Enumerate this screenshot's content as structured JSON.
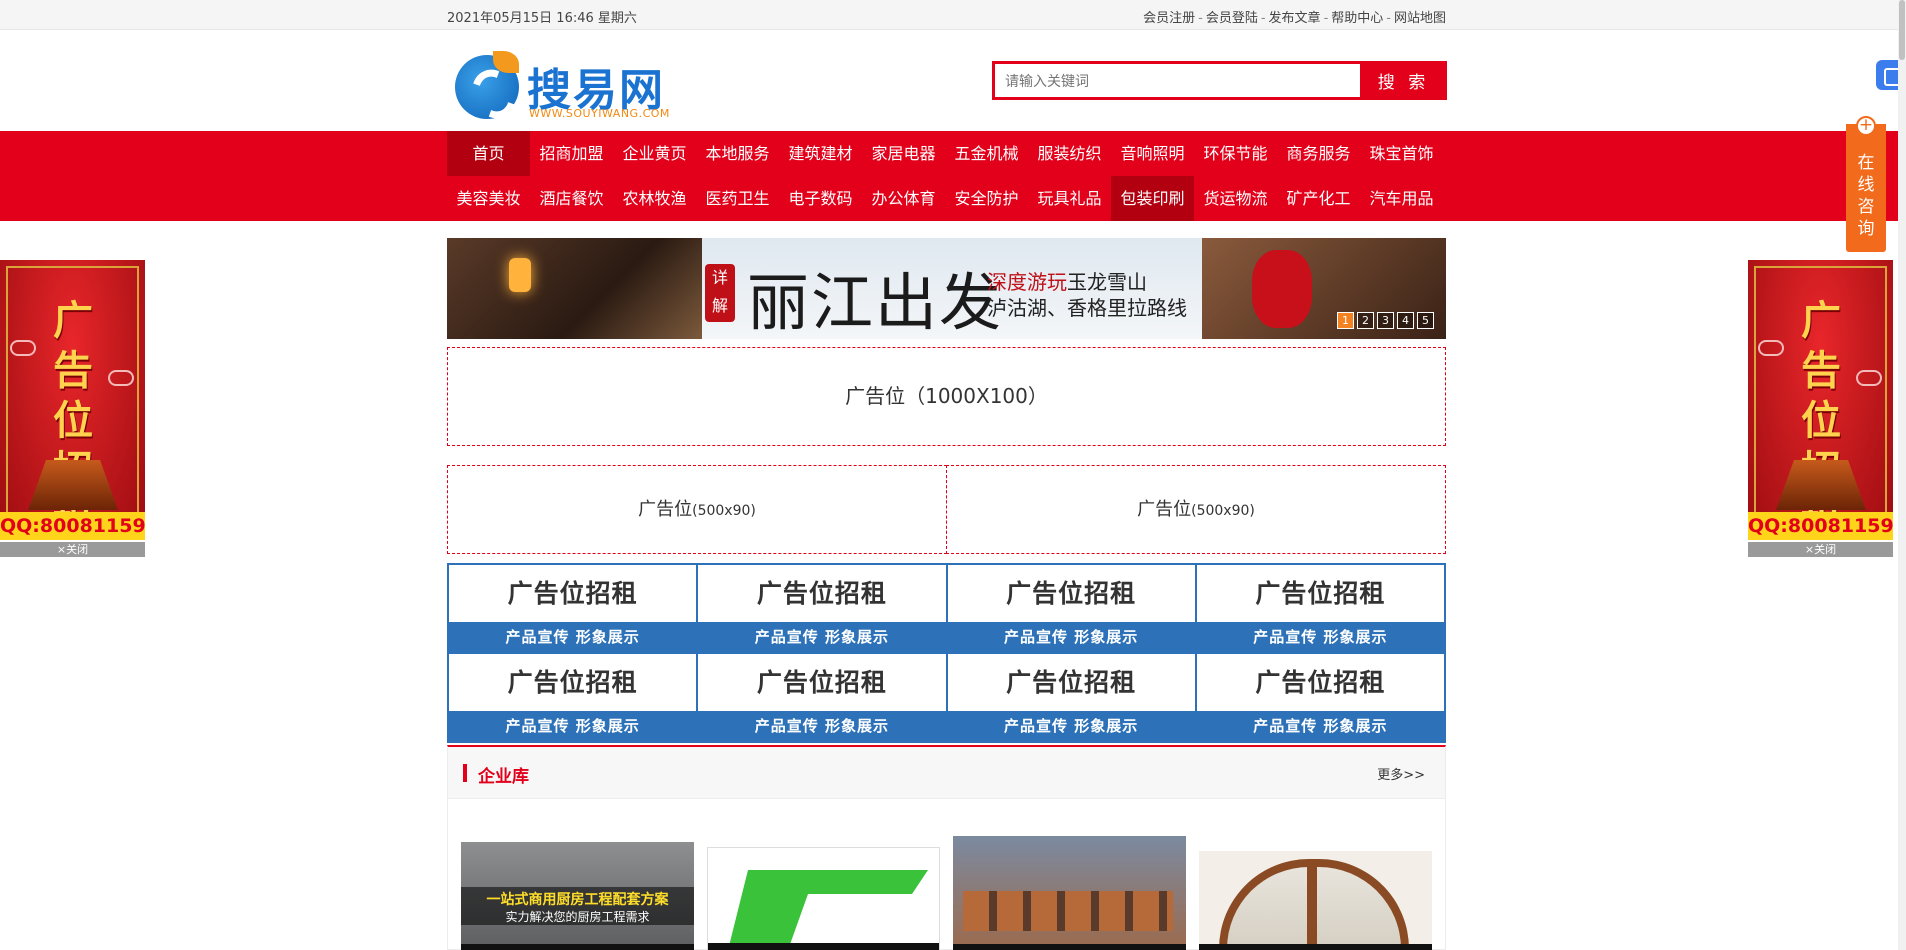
{
  "topbar": {
    "datetime": "2021年05月15日 16:46 星期六",
    "links": [
      "会员注册",
      "会员登陆",
      "发布文章",
      "帮助中心",
      "网站地图"
    ],
    "separator": "-"
  },
  "header": {
    "logo_name": "搜易网",
    "logo_url": "WWW.SOUYIWANG.COM",
    "search_placeholder": "请输入关键词",
    "search_button": "搜 索"
  },
  "nav": {
    "row1": [
      "首页",
      "招商加盟",
      "企业黄页",
      "本地服务",
      "建筑建材",
      "家居电器",
      "五金机械",
      "服装纺织",
      "音响照明",
      "环保节能",
      "商务服务",
      "珠宝首饰"
    ],
    "row2": [
      "美容美妆",
      "酒店餐饮",
      "农林牧渔",
      "医药卫生",
      "电子数码",
      "办公体育",
      "安全防护",
      "玩具礼品",
      "包装印刷",
      "货运物流",
      "矿产化工",
      "汽车用品"
    ]
  },
  "consult": {
    "plus": "+",
    "label": "在线咨询"
  },
  "couplet": {
    "text": "广告位招租",
    "qq": "QQ:80081159",
    "close": "×关闭"
  },
  "banner": {
    "badge": "详解",
    "title": "丽江出发",
    "sub1_highlight": "深度游玩",
    "sub1_rest": "玉龙雪山",
    "sub2": "泸沽湖、香格里拉路线",
    "dots": [
      "1",
      "2",
      "3",
      "4",
      "5"
    ]
  },
  "ads": {
    "big": "广告位（1000X100）",
    "half_label": "广告位",
    "half_size": "(500x90)"
  },
  "rental": {
    "title": "广告位招租",
    "subtitle": "产品宣传 形象展示"
  },
  "library": {
    "title": "企业库",
    "more": "更多>>",
    "thumb1_line1": "一站式商用厨房工程配套方案",
    "thumb1_line2": "实力解决您的厨房工程需求"
  }
}
